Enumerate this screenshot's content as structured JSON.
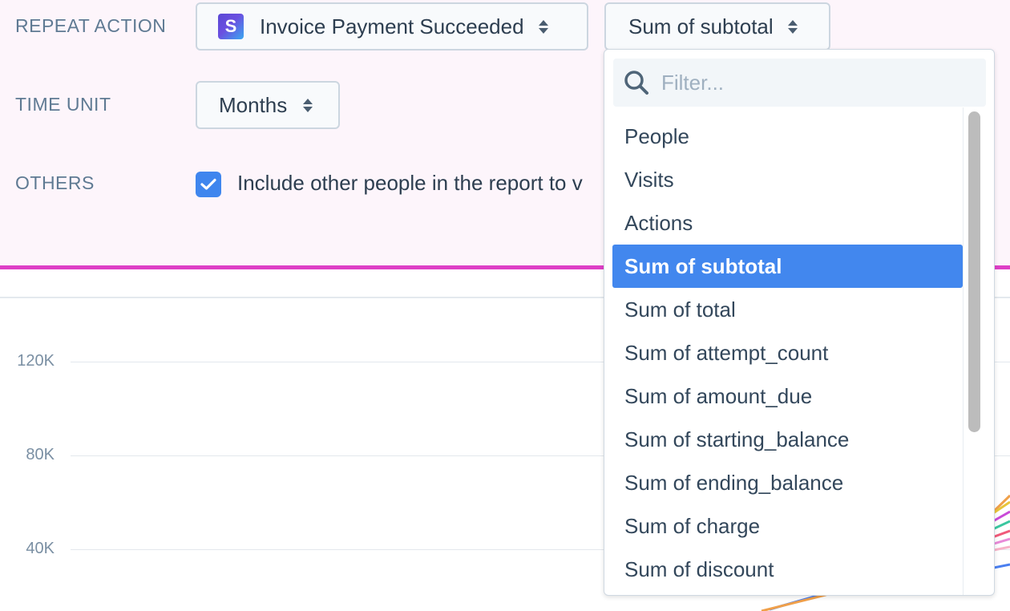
{
  "settings": {
    "repeat_action": {
      "label": "REPEAT ACTION",
      "event_select": {
        "icon": "stripe-logo",
        "logo_letter": "S",
        "value": "Invoice Payment Succeeded"
      },
      "metric_select": {
        "value": "Sum of subtotal"
      }
    },
    "time_unit": {
      "label": "TIME UNIT",
      "value": "Months"
    },
    "others": {
      "label": "OTHERS",
      "checked": true,
      "text": "Include other people in the report to v"
    }
  },
  "chart": {
    "y_ticks": [
      "120K",
      "80K",
      "40K"
    ]
  },
  "dropdown": {
    "filter_placeholder": "Filter...",
    "search_icon": "search-icon",
    "options": [
      "People",
      "Visits",
      "Actions",
      "Sum of subtotal",
      "Sum of total",
      "Sum of attempt_count",
      "Sum of amount_due",
      "Sum of starting_balance",
      "Sum of ending_balance",
      "Sum of charge",
      "Sum of discount"
    ],
    "selected_index": 3
  },
  "colors": {
    "accent_line": "#de3fc6",
    "selected_option": "#4287ee",
    "checkbox": "#3f86ee",
    "settings_bg": "#fdf5fb"
  }
}
